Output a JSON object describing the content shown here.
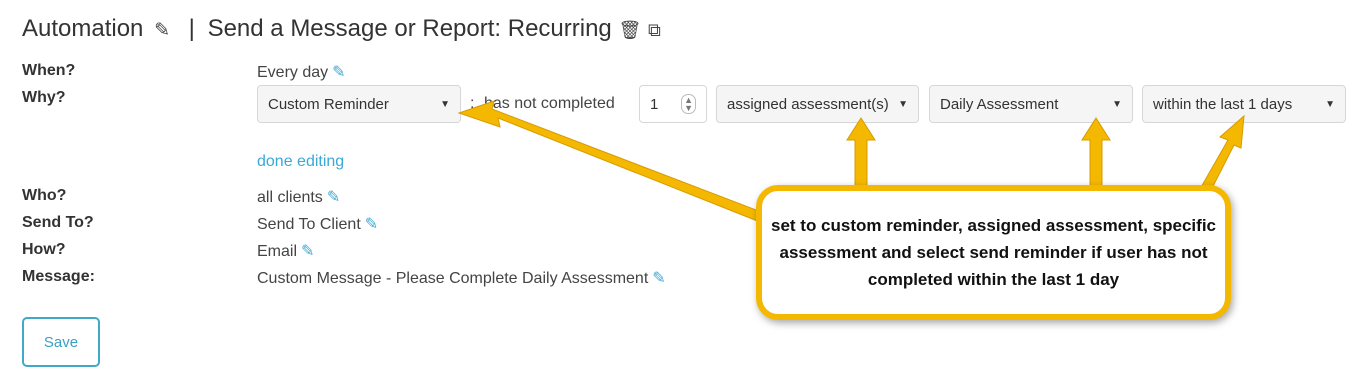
{
  "header": {
    "automation": "Automation",
    "separator": "|",
    "title": "Send a Message or Report: Recurring"
  },
  "fields": {
    "when_label": "When?",
    "when_value": "Every day",
    "why_label": "Why?",
    "who_label": "Who?",
    "who_value": "all clients",
    "send_to_label": "Send To?",
    "send_to_value": "Send To Client",
    "how_label": "How?",
    "how_value": "Email",
    "message_label": "Message:",
    "message_value": "Custom Message - Please Complete Daily Assessment"
  },
  "why": {
    "reason_select": "Custom Reminder",
    "colon": ":",
    "condition_text": "has not completed",
    "count_value": "1",
    "type_select": "assigned assessment(s)",
    "assessment_select": "Daily Assessment",
    "timeframe_select": "within the last 1 days"
  },
  "done_editing": "done editing",
  "save_label": "Save",
  "callout": {
    "text": "set to custom reminder, assigned assessment, specific assessment and select send reminder if user has not completed within the last 1 day"
  },
  "colors": {
    "accent": "#3aa9d6",
    "callout_border": "#f5b800",
    "arrow_fill": "#f5b800"
  },
  "icons": {
    "edit": "pencil-icon",
    "delete": "trash-icon",
    "copy": "copy-icon",
    "dropdown": "caret-down-icon",
    "stepper": "spinner-icon"
  }
}
